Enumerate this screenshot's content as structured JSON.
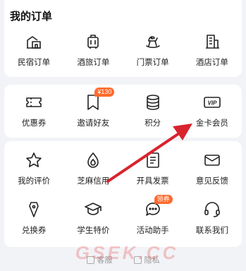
{
  "orders": {
    "title": "我的订单",
    "items": [
      {
        "label": "民宿订单",
        "icon": "house-icon"
      },
      {
        "label": "酒旅订单",
        "icon": "luggage-icon"
      },
      {
        "label": "门票订单",
        "icon": "rocking-horse-icon"
      },
      {
        "label": "酒店订单",
        "icon": "hotel-building-icon"
      }
    ]
  },
  "services1": {
    "items": [
      {
        "label": "优惠券",
        "icon": "ticket-icon"
      },
      {
        "label": "邀请好友",
        "icon": "bookmark-icon",
        "badge": "¥130"
      },
      {
        "label": "积分",
        "icon": "coins-stack-icon"
      },
      {
        "label": "金卡会员",
        "icon": "vip-card-icon",
        "icon_text": "VIP"
      }
    ]
  },
  "services2": {
    "items": [
      {
        "label": "我的评价",
        "icon": "star-icon"
      },
      {
        "label": "芝麻信用",
        "icon": "sesame-icon"
      },
      {
        "label": "开具发票",
        "icon": "invoice-icon"
      },
      {
        "label": "意见反馈",
        "icon": "mail-icon"
      },
      {
        "label": "兑换券",
        "icon": "voucher-tag-icon"
      },
      {
        "label": "学生特价",
        "icon": "graduation-cap-icon"
      },
      {
        "label": "活动助手",
        "icon": "chat-sparkle-icon",
        "badge": "领券"
      },
      {
        "label": "联系我们",
        "icon": "headset-icon"
      }
    ]
  },
  "footer": {
    "links": [
      "客服",
      "隐私"
    ]
  },
  "watermark": "GSEK.CC",
  "colors": {
    "accent": "#ff6a2b",
    "annotation_arrow": "#d9232d",
    "card": "#ffffff",
    "background": "#f2f3f7"
  }
}
